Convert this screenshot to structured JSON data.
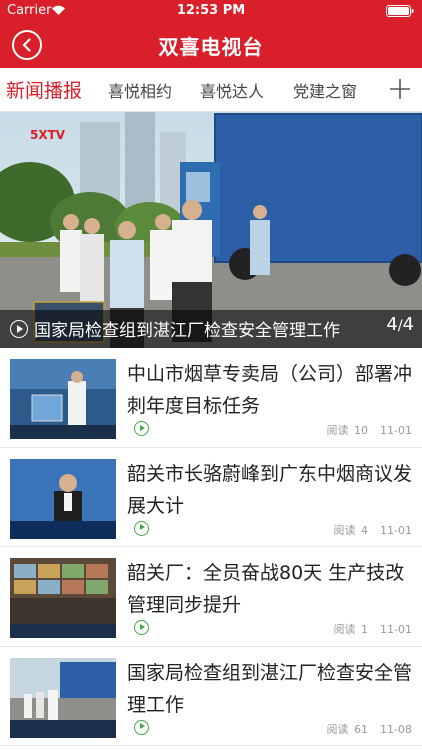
{
  "status": {
    "carrier": "Carrier",
    "time": "12:53 PM"
  },
  "nav": {
    "title": "双喜电视台"
  },
  "tabs": [
    "新闻播报",
    "喜悦相约",
    "喜悦达人",
    "党建之窗"
  ],
  "banner": {
    "title": "国家局检查组到湛江厂检查安全管理工作",
    "page_current": "4",
    "page_total": "4",
    "logo": "5XTV"
  },
  "news": [
    {
      "title": "中山市烟草专卖局（公司）部署冲刺年度目标任务",
      "read_label": "阅读",
      "reads": "10",
      "date": "11-01"
    },
    {
      "title": "韶关市长骆蔚峰到广东中烟商议发展大计",
      "read_label": "阅读",
      "reads": "4",
      "date": "11-01"
    },
    {
      "title": "韶关厂：全员奋战80天 生产技改管理同步提升",
      "read_label": "阅读",
      "reads": "1",
      "date": "11-01"
    },
    {
      "title": "国家局检查组到湛江厂检查安全管理工作",
      "read_label": "阅读",
      "reads": "61",
      "date": "11-08"
    }
  ],
  "colors": {
    "brand_red": "#d9202a",
    "play_green": "#46a64a"
  }
}
